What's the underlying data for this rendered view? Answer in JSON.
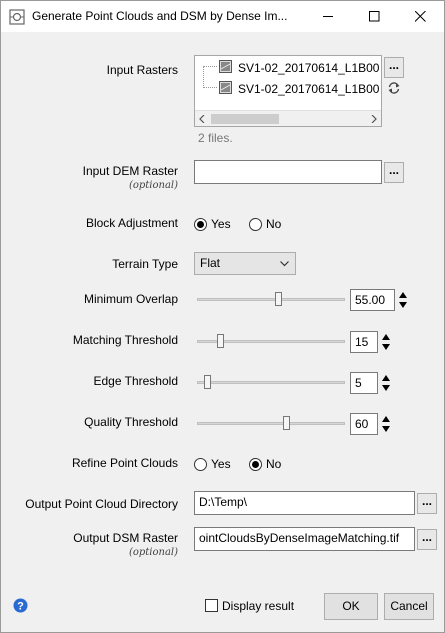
{
  "window": {
    "title": "Generate Point Clouds and DSM by Dense Im...",
    "minimize_icon": "minimize-icon",
    "maximize_icon": "maximize-icon",
    "close_icon": "close-icon"
  },
  "input_rasters": {
    "label": "Input Rasters",
    "files": [
      "SV1-02_20170614_L1B00",
      "SV1-02_20170614_L1B00"
    ],
    "count_text": "2 files.",
    "browse_label": "..."
  },
  "input_dem": {
    "label": "Input DEM Raster",
    "optional": "(optional)",
    "value": "",
    "browse_label": "..."
  },
  "block_adjustment": {
    "label": "Block Adjustment",
    "options": [
      "Yes",
      "No"
    ],
    "selected": "Yes"
  },
  "terrain_type": {
    "label": "Terrain Type",
    "value": "Flat"
  },
  "minimum_overlap": {
    "label": "Minimum Overlap",
    "value": "55.00",
    "level": 0.55
  },
  "matching_threshold": {
    "label": "Matching Threshold",
    "value": "15",
    "level": 0.15
  },
  "edge_threshold": {
    "label": "Edge Threshold",
    "value": "5",
    "level": 0.05
  },
  "quality_threshold": {
    "label": "Quality Threshold",
    "value": "60",
    "level": 0.6
  },
  "refine_point_clouds": {
    "label": "Refine Point Clouds",
    "options": [
      "Yes",
      "No"
    ],
    "selected": "No"
  },
  "output_point_cloud_dir": {
    "label": "Output Point Cloud Directory",
    "value": "D:\\Temp\\",
    "browse_label": "..."
  },
  "output_dsm": {
    "label": "Output DSM Raster",
    "optional": "(optional)",
    "value": "ointCloudsByDenseImageMatching.tif",
    "browse_label": "..."
  },
  "footer": {
    "help_icon": "help-icon",
    "display_result_label": "Display result",
    "display_result_checked": false,
    "ok_label": "OK",
    "cancel_label": "Cancel"
  },
  "colors": {
    "accent": "#0a64c8",
    "help_blue": "#2a6bd1"
  }
}
